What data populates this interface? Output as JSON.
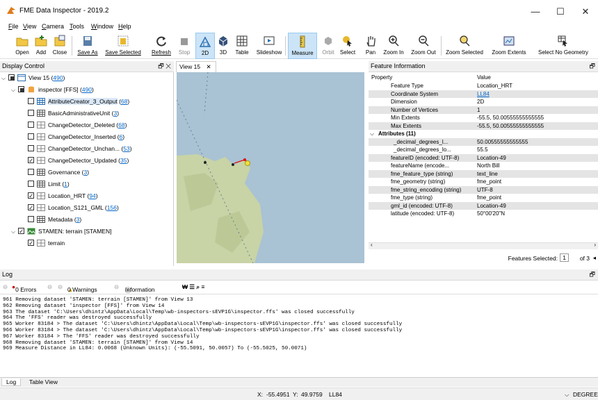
{
  "window": {
    "title": "FME Data Inspector - 2019.2",
    "min": "—",
    "max": "☐",
    "close": "✕"
  },
  "menu": [
    "File",
    "View",
    "Camera",
    "Tools",
    "Window",
    "Help"
  ],
  "toolbar": [
    {
      "label": "Open",
      "icon": "folder-open-icon"
    },
    {
      "label": "Add",
      "icon": "add-dataset-icon"
    },
    {
      "label": "Close",
      "icon": "close-dataset-icon"
    },
    {
      "label": "Save As",
      "icon": "save-as-icon"
    },
    {
      "label": "Save Selected",
      "icon": "save-selected-icon"
    },
    {
      "label": "Refresh",
      "icon": "refresh-icon"
    },
    {
      "label": "Stop",
      "icon": "stop-icon"
    },
    {
      "label": "2D",
      "icon": "2d-view-icon"
    },
    {
      "label": "3D",
      "icon": "3d-view-icon"
    },
    {
      "label": "Table",
      "icon": "table-icon"
    },
    {
      "label": "Slideshow",
      "icon": "slideshow-icon"
    },
    {
      "label": "Measure",
      "icon": "measure-icon"
    },
    {
      "label": "Orbit",
      "icon": "orbit-icon"
    },
    {
      "label": "Select",
      "icon": "select-icon"
    },
    {
      "label": "Pan",
      "icon": "pan-hand-icon"
    },
    {
      "label": "Zoom In",
      "icon": "zoom-in-icon"
    },
    {
      "label": "Zoom Out",
      "icon": "zoom-out-icon"
    },
    {
      "label": "Zoom Selected",
      "icon": "zoom-selected-icon"
    },
    {
      "label": "Zoom Extents",
      "icon": "zoom-extents-icon"
    },
    {
      "label": "Select No Geometry",
      "icon": "select-no-geometry-icon"
    }
  ],
  "display_control": {
    "title": "Display Control",
    "tree": [
      {
        "label": "View 15",
        "count": "490"
      },
      {
        "label": "inspector [FFS]",
        "count": "490"
      },
      {
        "label": "AttributeCreator_3_Output",
        "count": "68"
      },
      {
        "label": "BasicAdministrativeUnit",
        "count": "3"
      },
      {
        "label": "ChangeDetector_Deleted",
        "count": "68"
      },
      {
        "label": "ChangeDetector_Inserted",
        "count": "6"
      },
      {
        "label": "ChangeDetector_Unchan...",
        "count": "53"
      },
      {
        "label": "ChangeDetector_Updated",
        "count": "35"
      },
      {
        "label": "Governance",
        "count": "3"
      },
      {
        "label": "Limit",
        "count": "1"
      },
      {
        "label": "Location_HRT",
        "count": "94"
      },
      {
        "label": "Location_S121_GML",
        "count": "156"
      },
      {
        "label": "Metadata",
        "count": "3"
      },
      {
        "label": "STAMEN: terrain [STAMEN]",
        "count": ""
      },
      {
        "label": "terrain",
        "count": ""
      }
    ]
  },
  "view_tab": {
    "label": "View 15",
    "close": "✕"
  },
  "feature_info": {
    "title": "Feature Information",
    "col_property": "Property",
    "col_value": "Value",
    "rows": [
      {
        "k": "Feature Type",
        "v": "Location_HRT"
      },
      {
        "k": "Coordinate System",
        "v": "LL84"
      },
      {
        "k": "Dimension",
        "v": "2D"
      },
      {
        "k": "Number of Vertices",
        "v": "1"
      },
      {
        "k": "Min Extents",
        "v": "-55.5, 50.00555555555555"
      },
      {
        "k": "Max Extents",
        "v": "-55.5, 50.00555555555555"
      }
    ],
    "group": "Attributes (11)",
    "attrs": [
      {
        "k": "_decimal_degrees_l...",
        "v": "50.00555555555555"
      },
      {
        "k": "_decimal_degrees_lo...",
        "v": "55.5"
      },
      {
        "k": "featureID (encoded: UTF-8)",
        "v": "Location-49"
      },
      {
        "k": "featureName (encode...",
        "v": "North Bill"
      },
      {
        "k": "fme_feature_type (string)",
        "v": "text_line"
      },
      {
        "k": "fme_geometry (string)",
        "v": "fme_point"
      },
      {
        "k": "fme_string_encoding (string)",
        "v": "UTF-8"
      },
      {
        "k": "fme_type (string)",
        "v": "fme_point"
      },
      {
        "k": "gml_id (encoded: UTF-8)",
        "v": "Location-49"
      },
      {
        "k": "latitude (encoded: UTF-8)",
        "v": "50°00'20\"N"
      }
    ],
    "features_selected_label": "Features Selected:",
    "features_selected": "1",
    "features_total": "of 3"
  },
  "log": {
    "title": "Log",
    "errors": "0 Errors",
    "warnings": "0 Warnings",
    "information": "Information",
    "lines": [
      "961 Removing dataset 'STAMEN: terrain [STAMEN]' from View 13",
      "962 Removing dataset 'inspector [FFS]' from View 14",
      "963 The dataset 'C:\\Users\\dhintz\\AppData\\Local\\Temp\\wb-inspectors-sEVP1G\\inspector.ffs' was closed successfully",
      "964 The 'FFS' reader was destroyed successfully",
      "965 Worker 83184 > The dataset 'C:\\Users\\dhintz\\AppData\\Local\\Temp\\wb-inspectors-sEVP1G\\inspector.ffs' was closed successfully",
      "966 Worker 83184 > The dataset 'C:\\Users\\dhintz\\AppData\\Local\\Temp\\wb-inspectors-sEVP1G\\inspector.ffs' was closed successfully",
      "967 Worker 83184 > The 'FFS' reader was destroyed successfully",
      "968 Removing dataset 'STAMEN: terrain [STAMEN]' from View 14",
      "969 Measure Distance in LL84: 0.0068 (Unknown Units): (-55.5091, 50.0057) To (-55.5025, 50.0071)"
    ]
  },
  "bottom_tabs": [
    "Log",
    "Table View"
  ],
  "status": {
    "x_label": "X:",
    "x": "-55.4951",
    "y_label": "Y:",
    "y": "49.9759",
    "crs": "LL84",
    "units": "DEGREE"
  },
  "colors": {
    "accent": "#0066cc",
    "selection": "#cce4f7",
    "error": "#cc0000",
    "map_water": "#a9c2d4",
    "map_land": "#c8d3a6"
  }
}
